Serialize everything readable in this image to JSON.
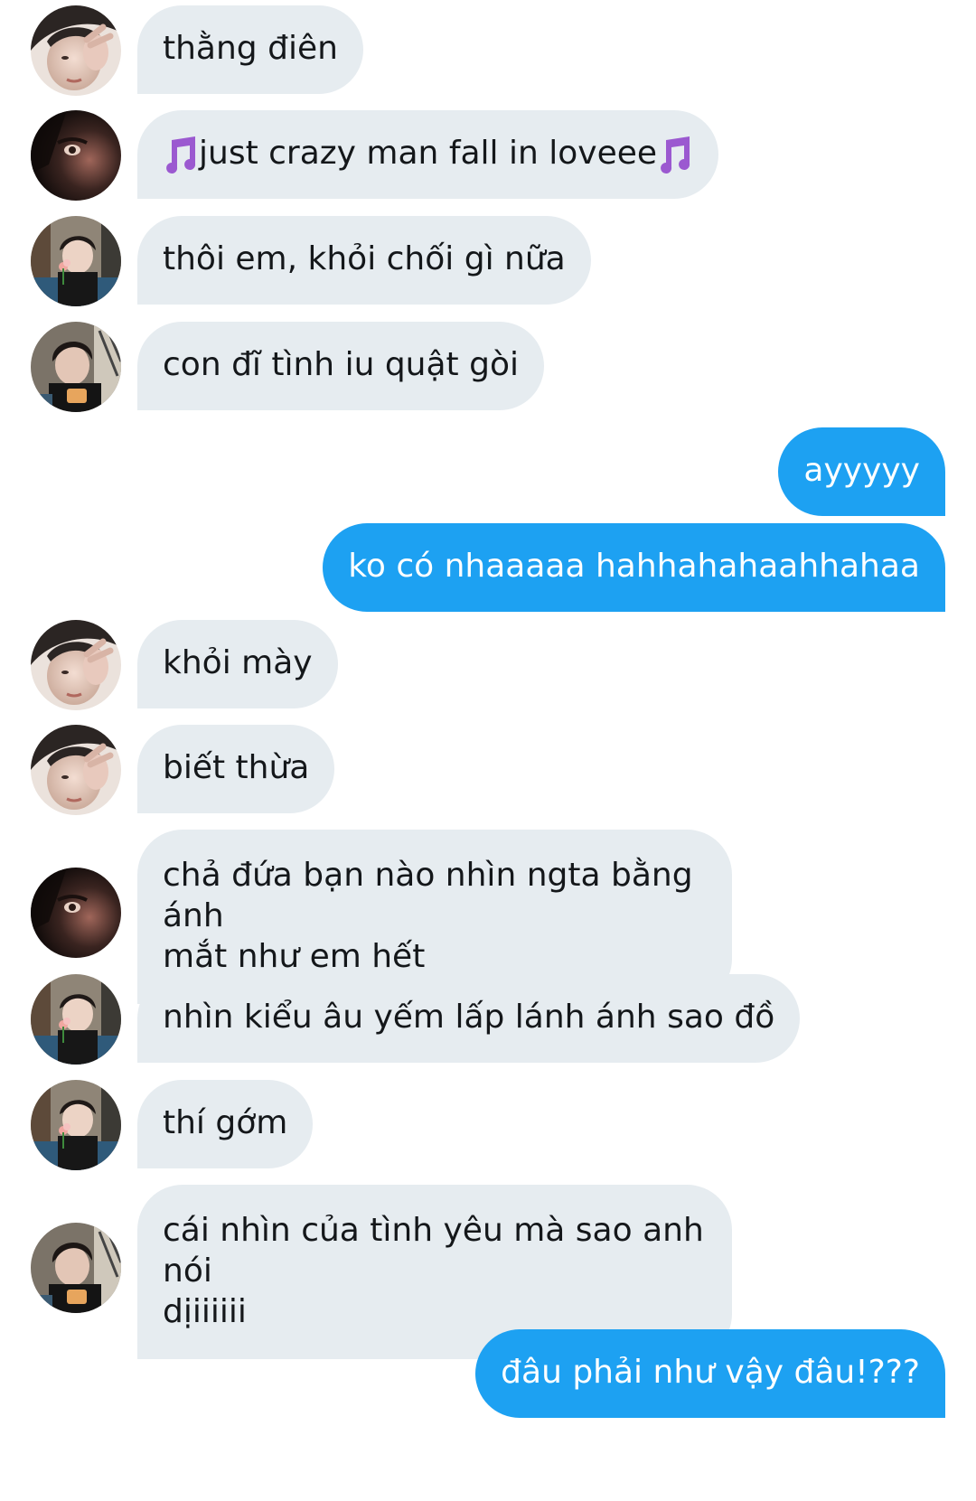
{
  "conversation": {
    "messages": [
      {
        "side": "in",
        "avatar": "avatar-peace-sign",
        "text": "thằng điên"
      },
      {
        "side": "in",
        "avatar": "avatar-dark-closeup",
        "text": "just crazy man fall in loveee",
        "decor": "musical-note-icon"
      },
      {
        "side": "in",
        "avatar": "avatar-flower-train",
        "text": "thôi em, khỏi chối gì nữa"
      },
      {
        "side": "in",
        "avatar": "avatar-bus-window",
        "text": "con đĩ tình iu quật gòi"
      },
      {
        "side": "out",
        "text": "ayyyyy"
      },
      {
        "side": "out",
        "text": "ko có nhaaaaa hahhahahaahhahaa"
      },
      {
        "side": "in",
        "avatar": "avatar-peace-sign",
        "text": "khỏi mày"
      },
      {
        "side": "in",
        "avatar": "avatar-peace-sign",
        "text": "biết thừa"
      },
      {
        "side": "in",
        "avatar": "avatar-dark-closeup",
        "text_line1": "chả đứa bạn nào nhìn ngta bằng ánh",
        "text_line2": "mắt như em hết"
      },
      {
        "side": "in",
        "avatar": "avatar-flower-train",
        "text": "nhìn kiểu âu yếm lấp lánh ánh sao đồ"
      },
      {
        "side": "in",
        "avatar": "avatar-flower-train",
        "text": "thí gớm"
      },
      {
        "side": "in",
        "avatar": "avatar-bus-window",
        "text_line1": "cái nhìn của tình yêu mà sao anh nói",
        "text_line2": "dịiiiiii"
      },
      {
        "side": "out",
        "text": "đâu phải như vậy đâu!???"
      }
    ]
  },
  "colors": {
    "incoming_bubble": "#e6ecf0",
    "outgoing_bubble": "#1da1f2",
    "incoming_text": "#14171a",
    "outgoing_text": "#ffffff",
    "musical_note": "#9b59d0"
  }
}
